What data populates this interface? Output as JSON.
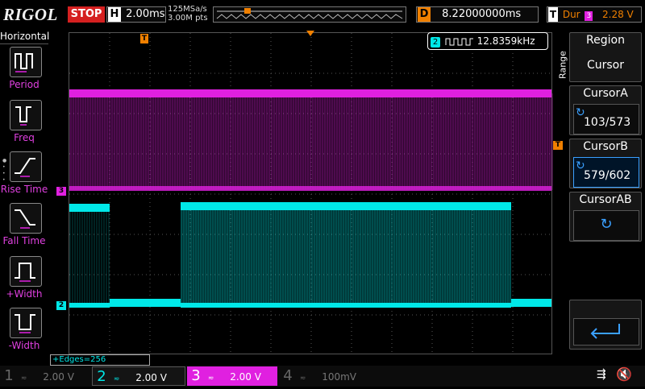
{
  "header": {
    "logo": "RIGOL",
    "run_state": "STOP",
    "timebase_key": "H",
    "timebase": "2.00ms",
    "sample_rate": "125MSa/s",
    "memory_depth": "3.00M pts",
    "delay_key": "D",
    "delay": "8.22000000ms",
    "trigger_key": "T",
    "trigger_mode": "Dur",
    "trigger_source": "3",
    "trigger_level": "2.28 V"
  },
  "left_menu": {
    "title": "Horizontal",
    "items": [
      {
        "label": "Period"
      },
      {
        "label": "Freq"
      },
      {
        "label": "Rise Time"
      },
      {
        "label": "Fall Time"
      },
      {
        "label": "+Width"
      },
      {
        "label": "-Width"
      }
    ]
  },
  "right_menu": {
    "range_label": "Range",
    "region_title": "Region",
    "region_value": "Cursor",
    "cursor_a_title": "CursorA",
    "cursor_a_value": "103/573",
    "cursor_b_title": "CursorB",
    "cursor_b_value": "579/602",
    "cursor_ab_title": "CursorAB"
  },
  "measurement": {
    "channel": "2",
    "value": "12.8359kHz"
  },
  "status": {
    "edges": "+Edges=256"
  },
  "markers": {
    "trigger_pos": "T",
    "trigger_level": "T",
    "ch3": "3",
    "ch2": "2"
  },
  "channels": [
    {
      "num": "1",
      "scale": "2.00 V",
      "color": "#e6e600"
    },
    {
      "num": "2",
      "scale": "2.00 V",
      "color": "#00e8e8"
    },
    {
      "num": "3",
      "scale": "2.00 V",
      "color": "#e020e0"
    },
    {
      "num": "4",
      "scale": "100mV",
      "color": "#2080ff"
    }
  ],
  "colors": {
    "ch2": "#00e8e8",
    "ch3": "#e020e0",
    "trigger": "#f08000",
    "stop": "#d52020",
    "menu_accent": "#3aa0ff"
  }
}
